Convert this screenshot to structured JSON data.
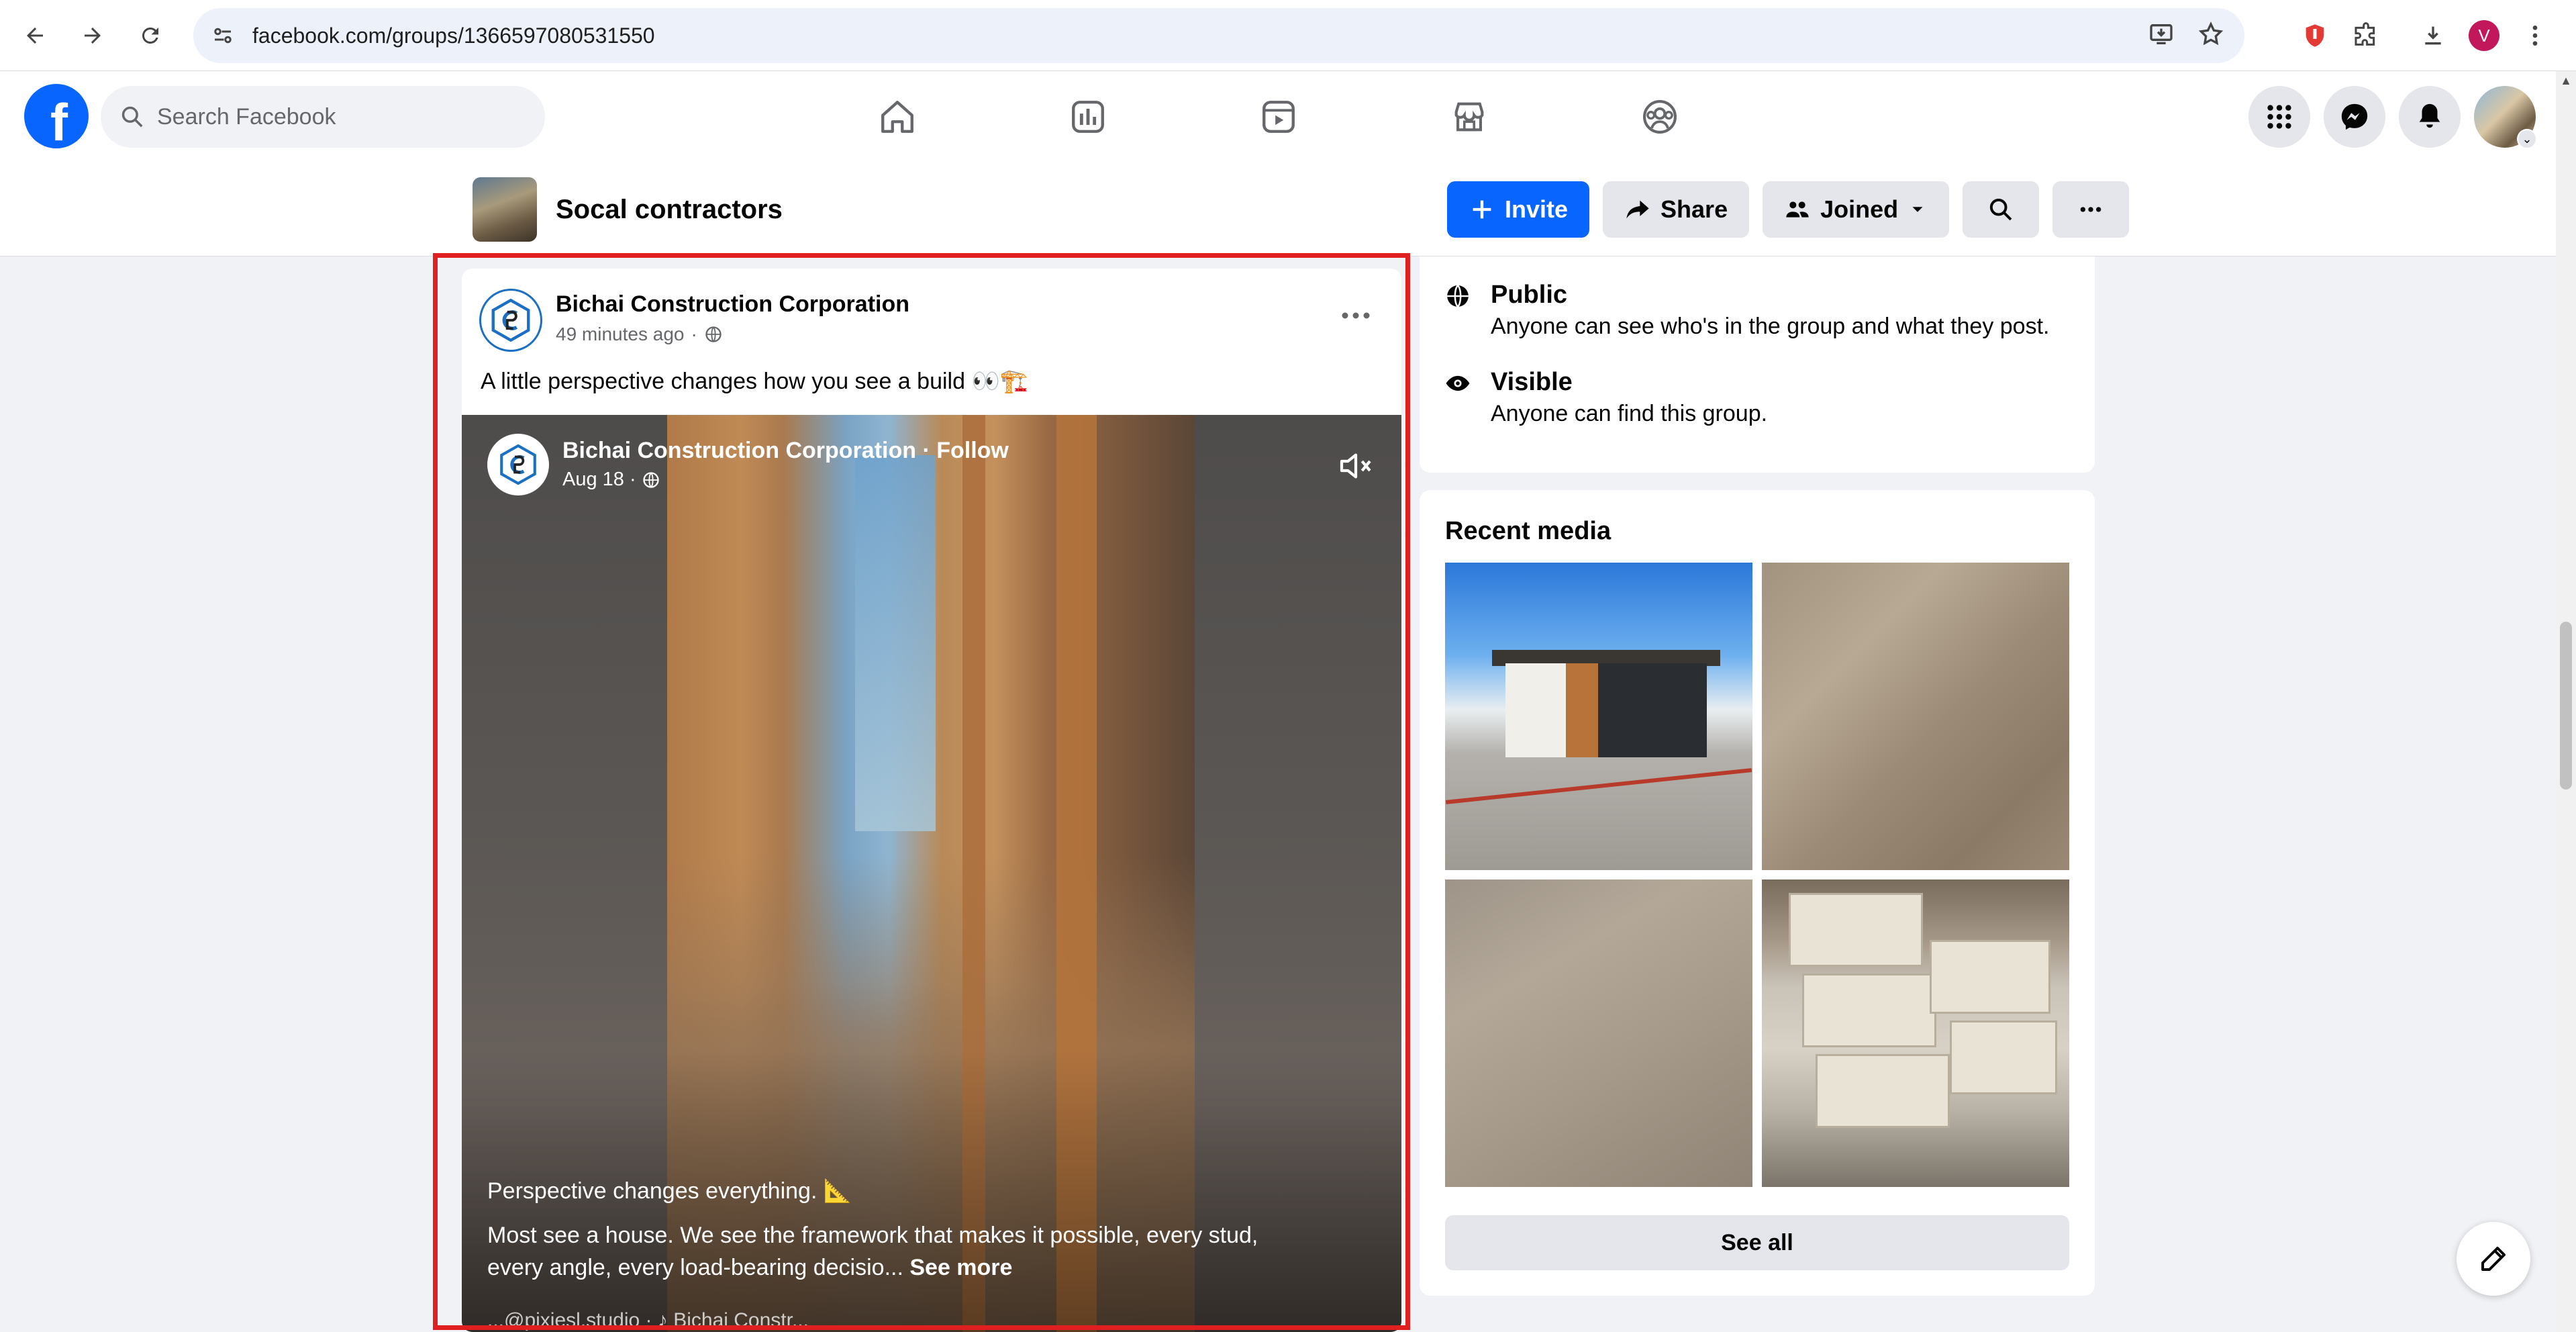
{
  "browser": {
    "url": "facebook.com/groups/1366597080531550",
    "profile_initial": "V"
  },
  "fb": {
    "search_placeholder": "Search Facebook",
    "brand_color": "#0866ff",
    "nav_tabs": [
      "home-icon",
      "dashboard-icon",
      "video-icon",
      "marketplace-icon",
      "groups-icon"
    ]
  },
  "group": {
    "name": "Socal contractors",
    "actions": {
      "invite": "Invite",
      "share": "Share",
      "joined": "Joined"
    }
  },
  "post": {
    "author": "Bichai Construction Corporation",
    "time": "49 minutes ago",
    "separator": "·",
    "text": "A little perspective changes how you see a build 👀🏗️",
    "video": {
      "author_follow": "Bichai Construction Corporation · Follow",
      "date": "Aug 18 ·",
      "caption_line1": "Perspective changes everything. 📐",
      "caption_body": "Most see a house. We see the framework that makes it possible, every stud, every angle, every load-bearing decisio...",
      "see_more": "See more",
      "caption_tail": "...@pixiesl.studio · ♪ Bichai Constr..."
    }
  },
  "sidebar": {
    "privacy": [
      {
        "title": "Public",
        "desc": "Anyone can see who's in the group and what they post.",
        "icon": "globe-icon"
      },
      {
        "title": "Visible",
        "desc": "Anyone can find this group.",
        "icon": "eye-icon"
      }
    ],
    "recent_media": {
      "title": "Recent media",
      "see_all": "See all"
    }
  },
  "colors": {
    "highlight": "#e02020",
    "background": "#f0f2f5"
  }
}
